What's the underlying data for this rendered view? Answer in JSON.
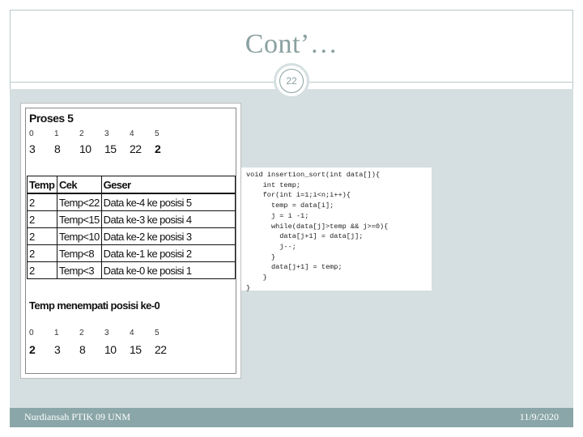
{
  "slide": {
    "title": "Cont’…",
    "page_number": "22",
    "footer_left": "Nurdiansah PTIK 09 UNM",
    "footer_right": "11/9/2020"
  },
  "figure": {
    "heading": "Proses 5",
    "indices": [
      "0",
      "1",
      "2",
      "3",
      "4",
      "5"
    ],
    "values_before": [
      "3",
      "8",
      "10",
      "15",
      "22",
      "2"
    ],
    "table_headers": [
      "Temp",
      "Cek",
      "Geser"
    ],
    "table_rows": [
      [
        "2",
        "Temp<22",
        "Data ke-4 ke posisi 5"
      ],
      [
        "2",
        "Temp<15",
        "Data ke-3 ke posisi 4"
      ],
      [
        "2",
        "Temp<10",
        "Data ke-2 ke posisi 3"
      ],
      [
        "2",
        "Temp<8",
        "Data ke-1 ke posisi 2"
      ],
      [
        "2",
        "Temp<3",
        "Data ke-0 ke posisi 1"
      ]
    ],
    "note": "Temp menempati posisi ke-0",
    "values_after": [
      "2",
      "3",
      "8",
      "10",
      "15",
      "22"
    ]
  },
  "code": {
    "lines": [
      "void insertion_sort(int data[]){",
      "    int temp;",
      "    for(int i=1;i<n;i++){",
      "      temp = data[i];",
      "      j = i -1;",
      "      while(data[j]>temp && j>=0){",
      "        data[j+1] = data[j];",
      "        j--;",
      "      }",
      "      data[j+1] = temp;",
      "    }",
      "}"
    ]
  },
  "colors": {
    "title": "#8aa0a0",
    "content_background": "#d5dfe1",
    "footer_bar": "#8aa6a8"
  }
}
